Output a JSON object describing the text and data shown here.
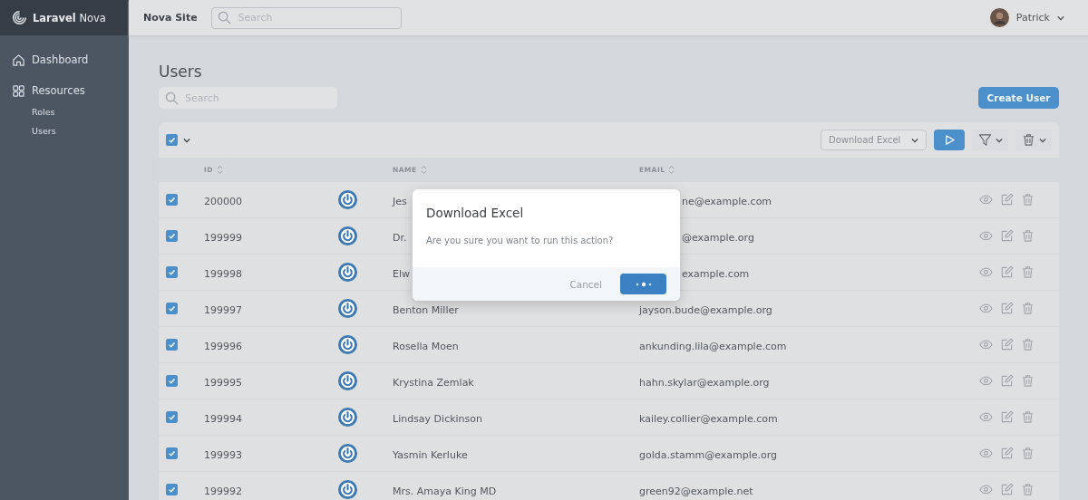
{
  "brand": {
    "bold": "Laravel",
    "light": "Nova"
  },
  "sidebar": {
    "items": [
      {
        "kind": "home",
        "label": "Dashboard"
      },
      {
        "kind": "grid",
        "label": "Resources",
        "children": [
          {
            "label": "Roles"
          },
          {
            "label": "Users"
          }
        ]
      }
    ]
  },
  "topbar": {
    "site": "Nova Site",
    "search": {
      "placeholder": "Search"
    },
    "user": "Patrick"
  },
  "page": {
    "title": "Users",
    "search": {
      "placeholder": "Search"
    },
    "create_button": "Create User"
  },
  "toolbar": {
    "select_all": {
      "checked": true
    },
    "action": "Download Excel"
  },
  "columns": [
    "ID",
    "NAME",
    "EMAIL"
  ],
  "rows": [
    {
      "id": "200000",
      "name": "Jes",
      "email": "ne@example.com",
      "checked": true,
      "obscured": true
    },
    {
      "id": "199999",
      "name": "Dr.",
      "email": "@example.org",
      "checked": true,
      "obscured": true
    },
    {
      "id": "199998",
      "name": "Elw",
      "email": "example.com",
      "checked": true,
      "obscured": true
    },
    {
      "id": "199997",
      "name": "Benton Miller",
      "email": "jayson.bude@example.org",
      "checked": true,
      "obscured": false
    },
    {
      "id": "199996",
      "name": "Rosella Moen",
      "email": "ankunding.lila@example.com",
      "checked": true,
      "obscured": false
    },
    {
      "id": "199995",
      "name": "Krystina Zemlak",
      "email": "hahn.skylar@example.org",
      "checked": true,
      "obscured": false
    },
    {
      "id": "199994",
      "name": "Lindsay Dickinson",
      "email": "kailey.collier@example.com",
      "checked": true,
      "obscured": false
    },
    {
      "id": "199993",
      "name": "Yasmin Kerluke",
      "email": "golda.stamm@example.org",
      "checked": true,
      "obscured": false
    },
    {
      "id": "199992",
      "name": "Mrs. Amaya King MD",
      "email": "green92@example.net",
      "checked": true,
      "obscured": false
    }
  ],
  "dialog": {
    "title": "Download Excel",
    "message": "Are you sure you want to run this action?",
    "cancel": "Cancel"
  }
}
